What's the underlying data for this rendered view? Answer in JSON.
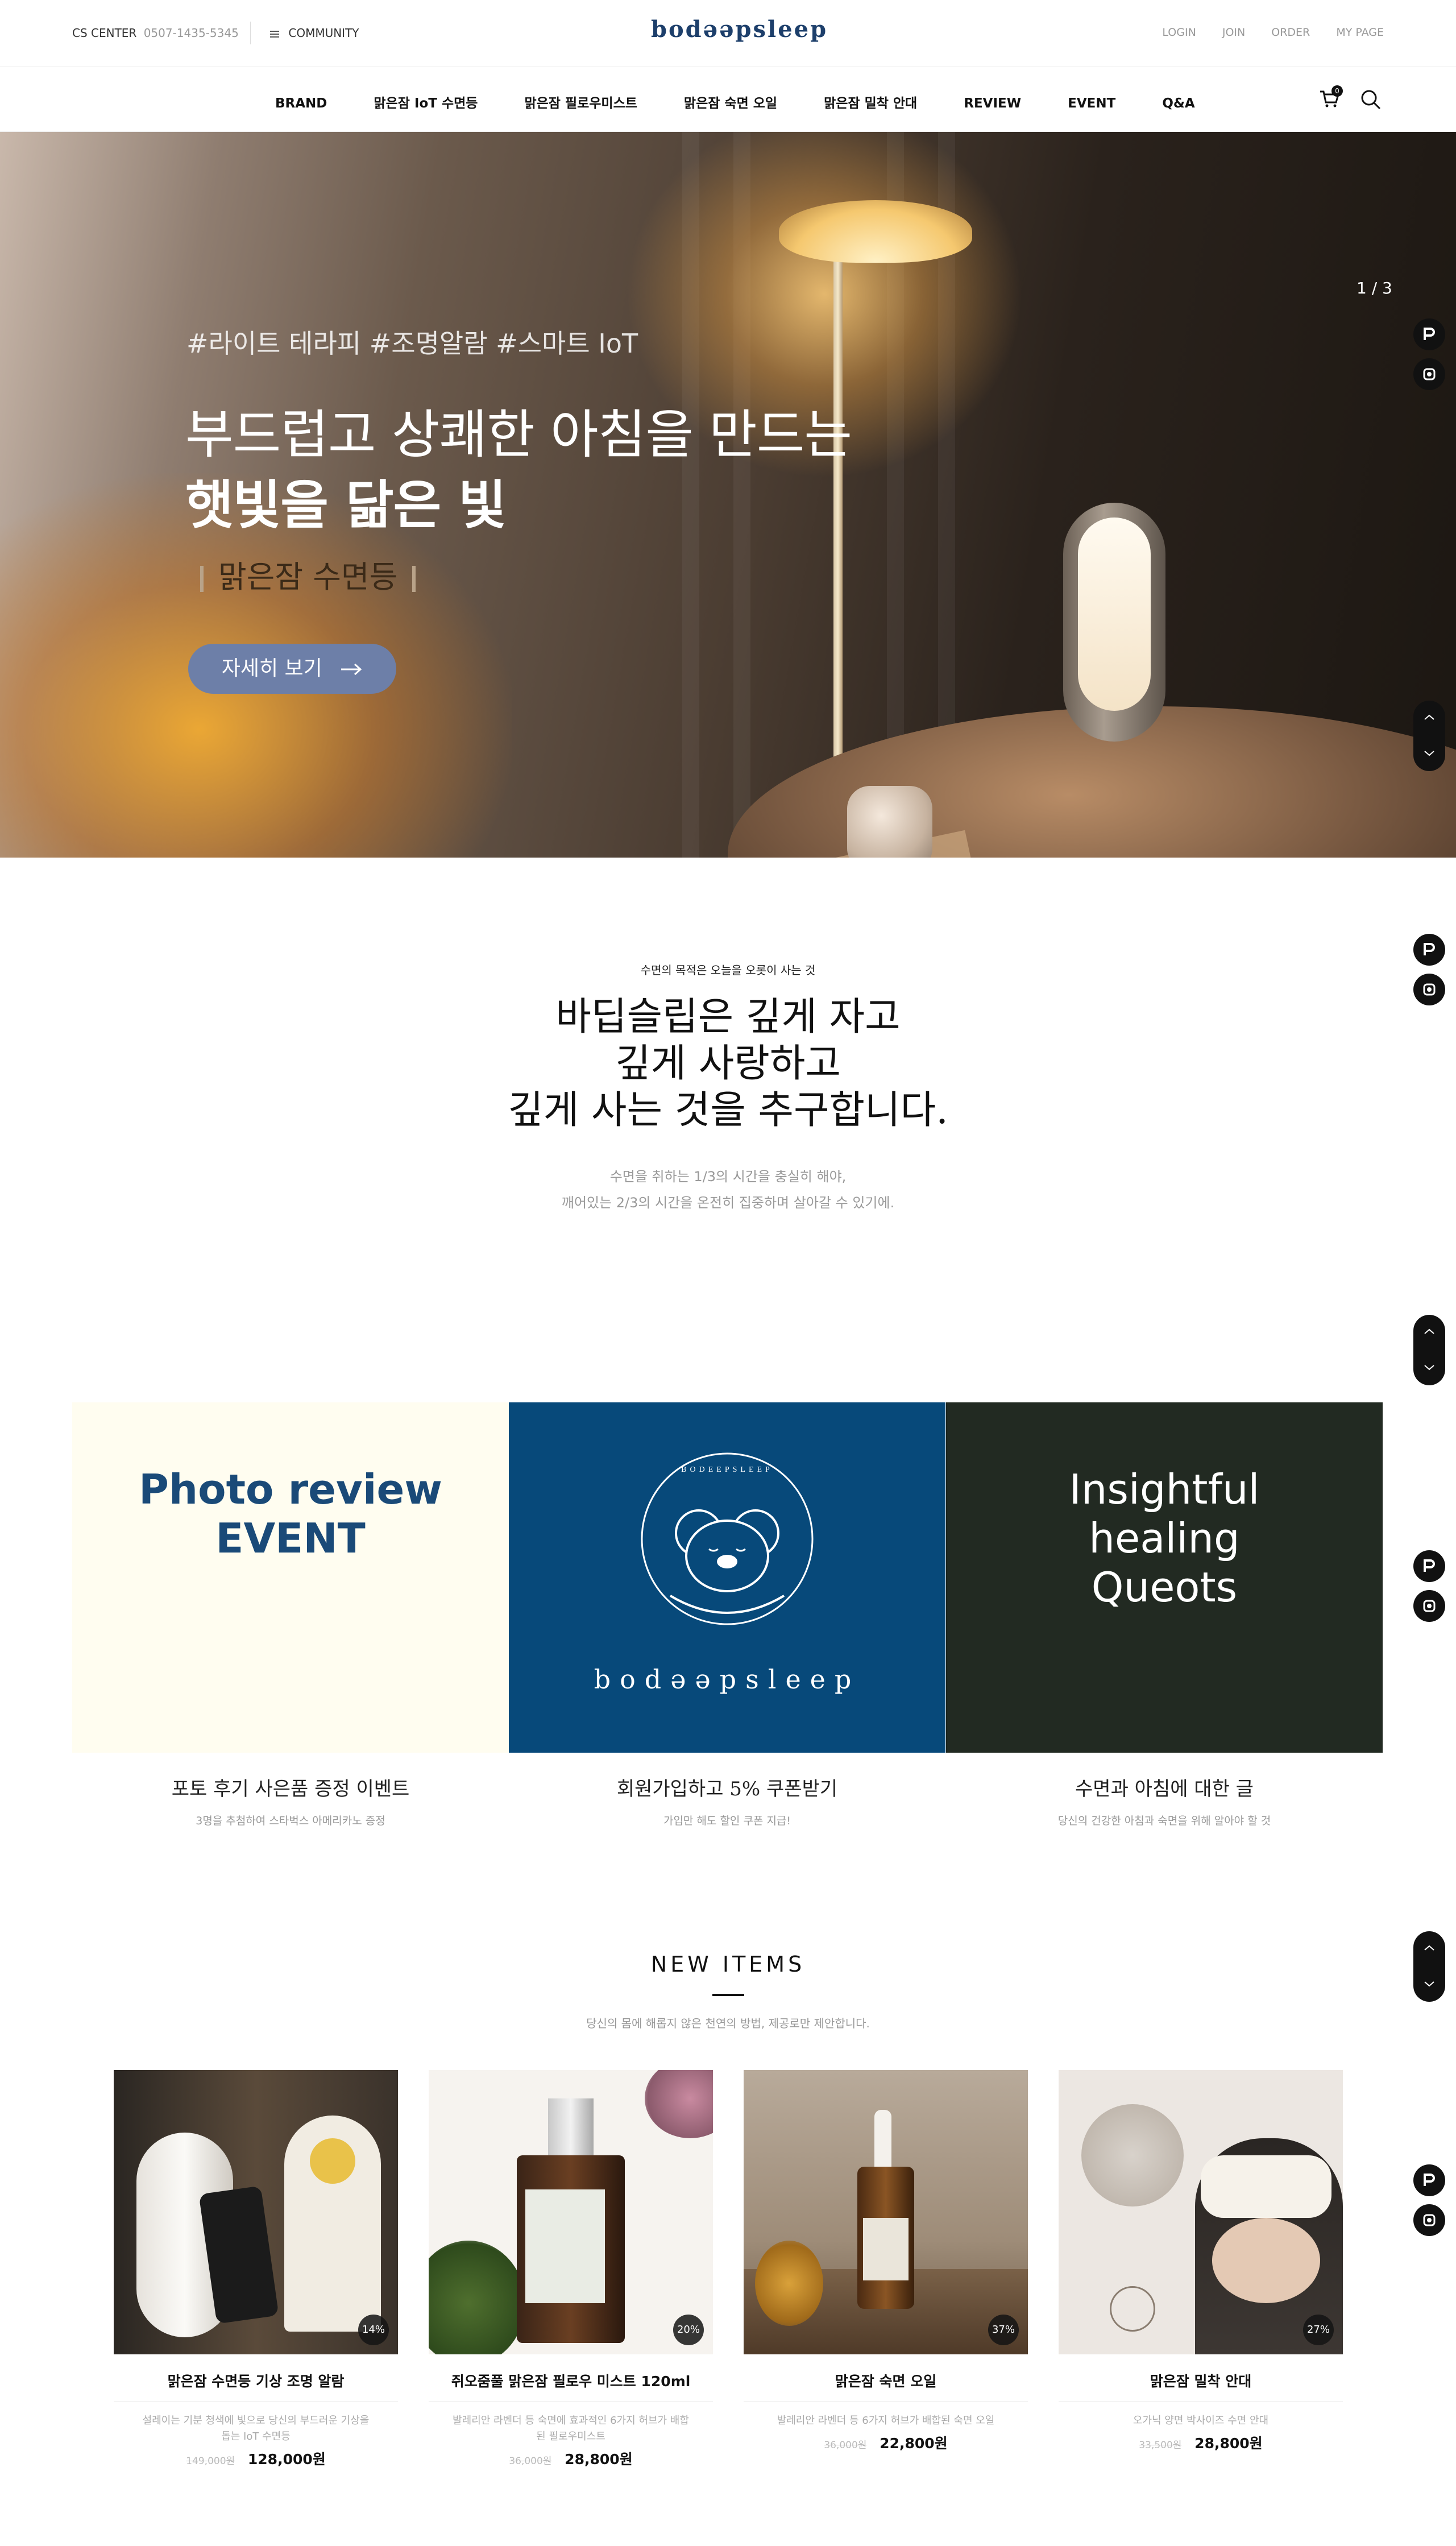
{
  "header": {
    "cs_label": "CS CENTER",
    "cs_phone": "0507-1435-5345",
    "community": "COMMUNITY",
    "logo": "bodəəpsleep",
    "utils": [
      "LOGIN",
      "JOIN",
      "ORDER",
      "MY PAGE"
    ]
  },
  "nav": {
    "items": [
      "BRAND",
      "맑은잠 IoT 수면등",
      "맑은잠 필로우미스트",
      "맑은잠 숙면 오일",
      "맑은잠 밀착 안대",
      "REVIEW",
      "EVENT",
      "Q&A"
    ],
    "cart_count": "0"
  },
  "hero": {
    "tags": "#라이트 테라피 #조명알람 #스마트 IoT",
    "line1": "부드럽고 상쾌한 아침을 만드는",
    "line2": "햇빛을 닮은 빛",
    "product": "맑은잠 수면등",
    "button": "자세히 보기",
    "counter": "1 / 3"
  },
  "philosophy": {
    "eyebrow": "수면의 목적은 오늘을 오롯이 사는 것",
    "headline": [
      "바딥슬립은 깊게 자고",
      "깊게 사랑하고",
      "깊게 사는 것을 추구합니다."
    ],
    "sub": [
      "수면을 취하는 1/3의 시간을 충실히 해야,",
      "깨어있는 2/3의 시간을 온전히 집중하며 살아갈 수 있기에."
    ]
  },
  "banners": [
    {
      "title": [
        "Photo review",
        "EVENT"
      ],
      "caption": "포토 후기 사은품 증정 이벤트",
      "sub": "3명을 추첨하여 스타벅스 아메리카노 증정"
    },
    {
      "brand": "bodəəpsleep",
      "emblem_text": "BODEEPSLEEP",
      "caption": "회원가입하고 5% 쿠폰받기",
      "sub": "가입만 해도 할인 쿠폰 지급!"
    },
    {
      "title": [
        "Insightful",
        "healing",
        "Queots"
      ],
      "caption": "수면과 아침에 대한 글",
      "sub": "당신의 건강한 아침과 숙면을 위해 알아야 할 것"
    }
  ],
  "new_items": {
    "title": "NEW ITEMS",
    "sub": "당신의 몸에 해롭지 않은 천연의 방법, 제공로만 제안합니다.",
    "products": [
      {
        "name": "맑은잠 수면등 기상 조명 알람",
        "desc": "설레이는 기분 청색에 빛으로 당신의 부드러운 기상을 돕는 IoT 수면등",
        "old_price": "149,000원",
        "price": "128,000원",
        "discount": "14%"
      },
      {
        "name": "쥐오줌풀 맑은잠 필로우 미스트 120ml",
        "desc": "발레리안 라벤더 등 숙면에 효과적인 6가지 허브가 배합된 필로우미스트",
        "old_price": "36,000원",
        "price": "28,800원",
        "discount": "20%"
      },
      {
        "name": "맑은잠 숙면 오일",
        "desc": "발레리안 라벤더 등 6가지 허브가 배합된 숙면 오일",
        "old_price": "36,000원",
        "price": "22,800원",
        "discount": "37%"
      },
      {
        "name": "맑은잠 밀착 안대",
        "desc": "오가닉 양면 박사이즈 수면 안대",
        "old_price": "33,500원",
        "price": "28,800원",
        "discount": "27%"
      }
    ]
  },
  "colors": {
    "navy": "#07497a",
    "forest": "#222a22",
    "cream": "#fffdf0",
    "hero_button": "#6d7fa8"
  }
}
